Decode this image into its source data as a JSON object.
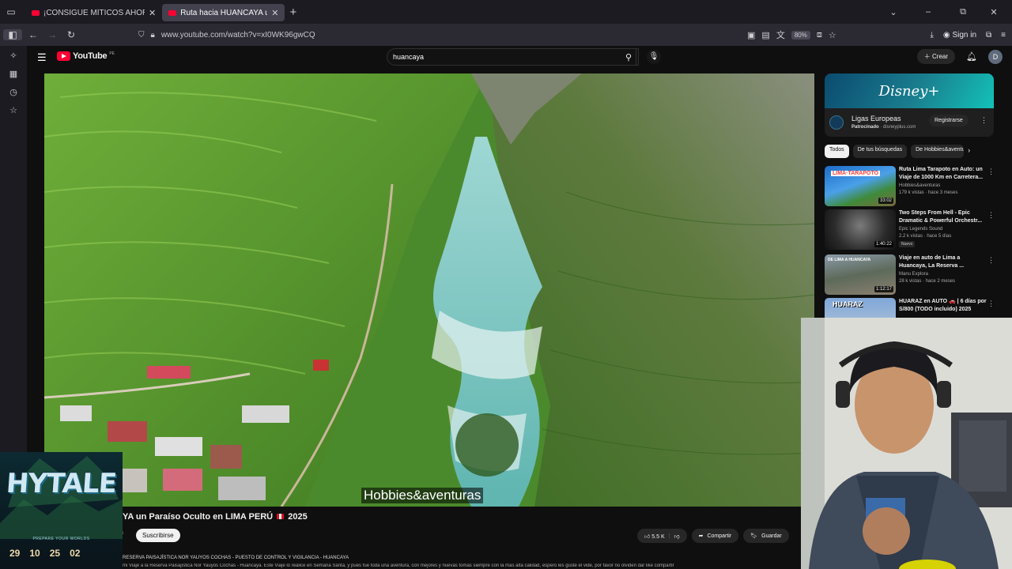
{
  "browser": {
    "tabs": [
      {
        "title": "¡CONSIGUE MÍTICOS AHORA! D",
        "active": false
      },
      {
        "title": "Ruta hacia HUANCAYA un Paraí",
        "active": true
      }
    ],
    "url": "www.youtube.com/watch?v=xI0WK96gwCQ",
    "zoom": "80%",
    "sign_in": "Sign in"
  },
  "youtube": {
    "logo_text": "YouTube",
    "country_code": "PE",
    "search_value": "huancaya",
    "create_label": "Crear",
    "avatar_letter": "D"
  },
  "player": {
    "caption": "Hobbies&aventuras"
  },
  "video": {
    "title_start": "YA un Paraíso Oculto en LIMA PERÚ",
    "title_end": "2025",
    "channel_fragment": "s",
    "subscribe_label": "Suscribirse",
    "likes": "5.5 K",
    "share_label": "Compartir",
    "save_label": "Guardar",
    "description_line1": "RESERVA PAISAJÍSTICA NOR YAUYOS COCHAS - PUESTO DE CONTROL Y VIGILANCIA - HUANCAYA",
    "description_line2": "mi Viaje a la Reserva Paisajística Nor Yauyos Cochas - Huancaya. Este Viaje lo realice en Semana Santa, y pues fue toda una aventura, con mejores y nuevas tomas siempre con la mas alta calidad, espero les guste el vide, por favor no olviden dar like compartir"
  },
  "ad": {
    "banner_text": "Disney+",
    "title": "Ligas Europeas",
    "sponsored": "Patrocinado",
    "domain": "disneyplus.com",
    "button": "Registrarse"
  },
  "chips": [
    "Todos",
    "De tus búsquedas",
    "De Hobbies&aventuras"
  ],
  "recommendations": [
    {
      "title": "Ruta Lima Tarapoto en Auto: un Viaje de 1000 Km en Carretera...",
      "channel": "Hobbies&aventuras",
      "meta": "179 k vistas · hace 3 meses",
      "duration": "33:02",
      "badge": ""
    },
    {
      "title": "Two Steps From Hell - Epic Dramatic & Powerful Orchestr...",
      "channel": "Epic Legends Sound",
      "meta": "2.2 k vistas · hace 5 días",
      "duration": "1:40:22",
      "badge": "Nuevo"
    },
    {
      "title": "Viaje en auto de Lima a Huancaya, La Reserva ...",
      "channel": "Manu Explora",
      "meta": "28 k vistas · hace 2 meses",
      "duration": "1:12:17",
      "badge": ""
    },
    {
      "title": "HUARAZ en AUTO 🚗 | 6 días por S/800 (TODO incluido) 2025",
      "channel": "",
      "meta": "",
      "duration": "",
      "badge": ""
    }
  ],
  "overlay": {
    "logo": "HYTALE",
    "tagline": "PREPARE YOUR WORLDS",
    "countdown": [
      "29",
      "10",
      "25",
      "02"
    ]
  },
  "colors": {
    "yt_red": "#ff0033",
    "background": "#0f0f0f",
    "browser_bar": "#2b2a33"
  }
}
